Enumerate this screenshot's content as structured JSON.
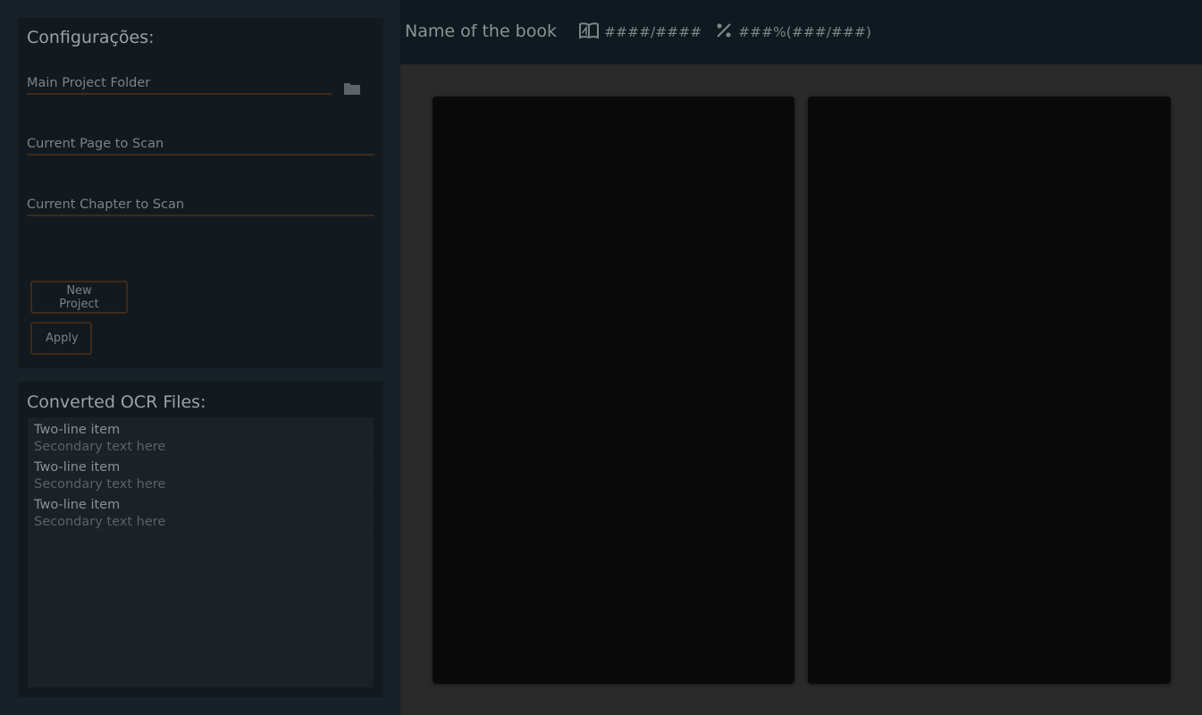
{
  "config": {
    "title": "Configurações:",
    "main_project_folder_placeholder": "Main Project Folder",
    "current_page_placeholder": "Current Page to Scan",
    "current_chapter_placeholder": "Current Chapter to Scan",
    "folder_icon": "folder-icon",
    "new_project_label": "New Project",
    "apply_label": "Apply"
  },
  "ocr": {
    "title": "Converted OCR Files:",
    "items": [
      {
        "primary": "Two-line item",
        "secondary": "Secondary text here"
      },
      {
        "primary": "Two-line item",
        "secondary": "Secondary text here"
      },
      {
        "primary": "Two-line item",
        "secondary": "Secondary text here"
      }
    ]
  },
  "header": {
    "book_name": "Name of the book",
    "pages_icon": "open-book-icon",
    "pages_value": "####/####",
    "percent_icon": "percent-icon",
    "percent_value": "###%(###/###)"
  },
  "colors": {
    "accent_border": "#3e2a18",
    "sidebar_bg": "#172127",
    "card_bg": "#121a1f",
    "topbar_bg": "#0e1a1f",
    "main_bg": "#2a2a2a",
    "panel_bg": "#0a0a0a"
  }
}
